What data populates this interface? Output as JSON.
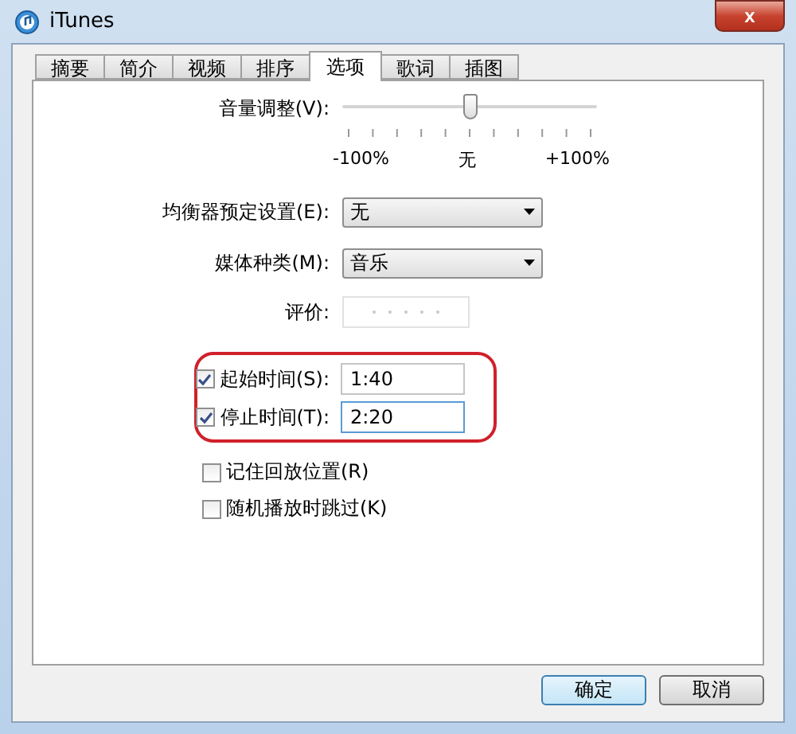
{
  "window": {
    "title": "iTunes",
    "close": "x"
  },
  "tabs": [
    {
      "label": "摘要",
      "selected": false
    },
    {
      "label": "简介",
      "selected": false
    },
    {
      "label": "视频",
      "selected": false
    },
    {
      "label": "排序",
      "selected": false
    },
    {
      "label": "选项",
      "selected": true
    },
    {
      "label": "歌词",
      "selected": false
    },
    {
      "label": "插图",
      "selected": false
    }
  ],
  "volume": {
    "label": "音量调整(V):",
    "level": 0.5,
    "min_label": "-100%",
    "mid_label": "无",
    "max_label": "+100%"
  },
  "equalizer": {
    "label": "均衡器预定设置(E):",
    "value": "无"
  },
  "media_kind": {
    "label": "媒体种类(M):",
    "value": "音乐"
  },
  "rating": {
    "label": "评价:",
    "stars": 0
  },
  "times": [
    {
      "label": "起始时间(S):",
      "checked": true,
      "value": "1:40",
      "focused": false
    },
    {
      "label": "停止时间(T):",
      "checked": true,
      "value": "2:20",
      "focused": true
    }
  ],
  "options": [
    {
      "label": "记住回放位置(R)",
      "checked": false
    },
    {
      "label": "随机播放时跳过(K)",
      "checked": false
    }
  ],
  "buttons": [
    {
      "label": "确定",
      "default": true
    },
    {
      "label": "取消",
      "default": false
    }
  ]
}
